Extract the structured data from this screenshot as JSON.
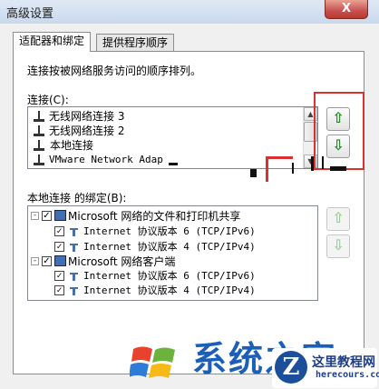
{
  "window": {
    "title": "高级设置",
    "close_glyph": "X"
  },
  "tabs": [
    {
      "label": "适配器和绑定",
      "active": true
    },
    {
      "label": "提供程序顺序",
      "active": false
    }
  ],
  "description": "连接按被网络服务访问的顺序排列。",
  "connections": {
    "label": "连接(C):",
    "items": [
      {
        "label": "无线网络连接 3",
        "selected": false
      },
      {
        "label": "无线网络连接 2",
        "selected": false
      },
      {
        "label": "本地连接",
        "selected": true
      },
      {
        "label": "VMware Network Adap",
        "selected": false
      }
    ]
  },
  "bindings": {
    "label": "本地连接 的绑定(B):",
    "items": [
      {
        "label": "Microsoft 网络的文件和打印机共享",
        "level": 0,
        "checked": true
      },
      {
        "label": "Internet 协议版本 6 (TCP/IPv6)",
        "level": 1,
        "checked": true
      },
      {
        "label": "Internet 协议版本 4 (TCP/IPv4)",
        "level": 1,
        "checked": true
      },
      {
        "label": "Microsoft 网络客户端",
        "level": 0,
        "checked": true
      },
      {
        "label": "Internet 协议版本 6 (TCP/IPv6)",
        "level": 1,
        "checked": true
      },
      {
        "label": "Internet 协议版本 4 (TCP/IPv4)",
        "level": 1,
        "checked": true
      }
    ]
  },
  "buttons": {
    "move_up_glyph": "⇧",
    "move_down_glyph": "⇩"
  },
  "watermark": {
    "brand": "系统之家",
    "site_name": "这里教程网",
    "site_url": "herecours.com",
    "logo_letter": "Z"
  },
  "colors": {
    "highlight": "#d83131",
    "selection": "#3399ff",
    "arrow_green": "#1e8a1e"
  }
}
